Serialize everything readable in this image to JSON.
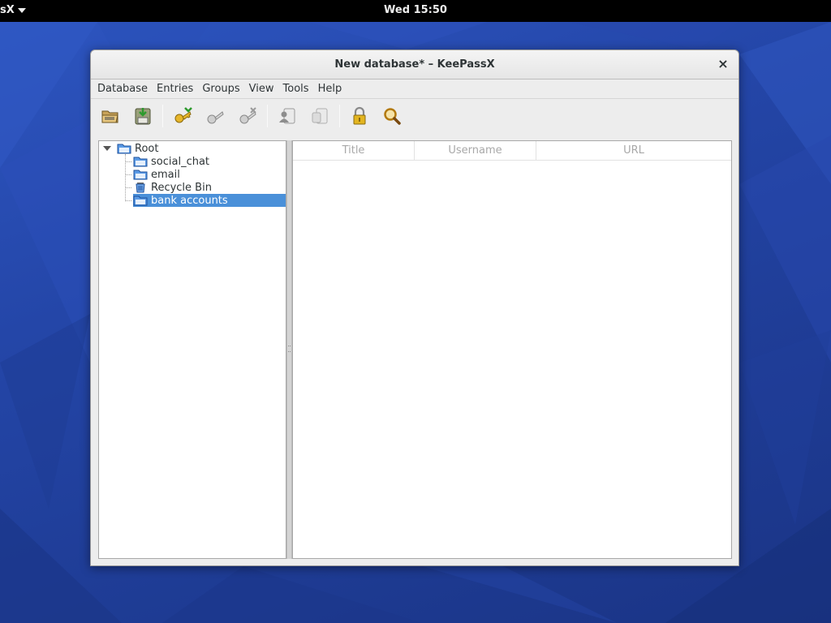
{
  "topbar": {
    "app_menu_label": "sX",
    "clock": "Wed 15:50"
  },
  "window": {
    "title": "New database* – KeePassX",
    "close_glyph": "×"
  },
  "menubar": {
    "items": [
      "Database",
      "Entries",
      "Groups",
      "View",
      "Tools",
      "Help"
    ]
  },
  "toolbar": {
    "buttons": [
      {
        "icon": "open-database-icon"
      },
      {
        "icon": "save-database-icon"
      },
      {
        "icon": "add-entry-icon"
      },
      {
        "icon": "edit-entry-icon"
      },
      {
        "icon": "delete-entry-icon"
      },
      {
        "icon": "copy-username-icon"
      },
      {
        "icon": "copy-password-icon"
      },
      {
        "icon": "lock-database-icon"
      },
      {
        "icon": "search-icon"
      }
    ]
  },
  "groups": {
    "root": "Root",
    "children": [
      "social_chat",
      "email",
      "Recycle Bin",
      "bank accounts"
    ],
    "selected": "bank accounts"
  },
  "entries": {
    "columns": [
      "Title",
      "Username",
      "URL"
    ]
  },
  "colors": {
    "selection": "#4a90d9",
    "desktop": "#2446a8"
  }
}
